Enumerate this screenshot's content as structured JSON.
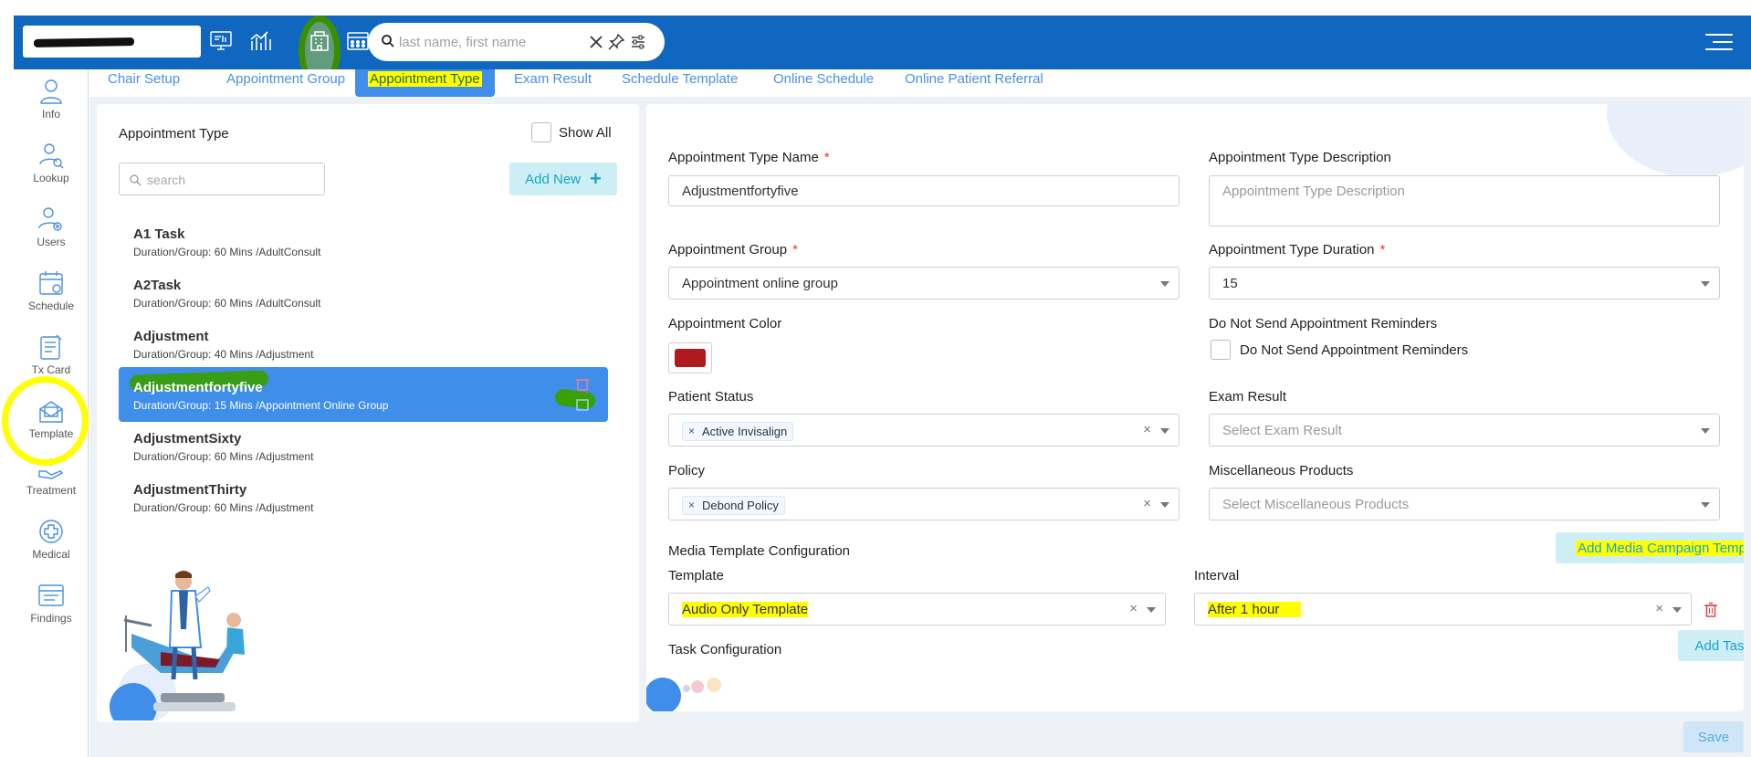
{
  "header": {
    "search_placeholder": "last name, first name",
    "nav_icons": [
      "dashboard-icon",
      "chart-bar-icon",
      "building-icon",
      "calendar-grid-icon"
    ],
    "accent_color": "#0f67c0"
  },
  "sidebar": {
    "items": [
      {
        "label": "Info",
        "icon": "user-icon"
      },
      {
        "label": "Lookup",
        "icon": "user-search-icon"
      },
      {
        "label": "Users",
        "icon": "user-settings-icon"
      },
      {
        "label": "Schedule",
        "icon": "calendar-icon"
      },
      {
        "label": "Tx Card",
        "icon": "card-icon"
      },
      {
        "label": "Template",
        "icon": "template-icon"
      },
      {
        "label": "Treatment",
        "icon": "hand-care-icon"
      },
      {
        "label": "Medical",
        "icon": "medical-cross-icon"
      },
      {
        "label": "Findings",
        "icon": "findings-icon"
      }
    ]
  },
  "tabs": [
    {
      "label": "Chair Setup"
    },
    {
      "label": "Appointment Group"
    },
    {
      "label": "Appointment Type",
      "active": true
    },
    {
      "label": "Exam Result"
    },
    {
      "label": "Schedule Template"
    },
    {
      "label": "Online Schedule"
    },
    {
      "label": "Online Patient Referral"
    }
  ],
  "left_panel": {
    "title": "Appointment Type",
    "show_all_label": "Show All",
    "search_placeholder": "search",
    "add_new_label": "Add New",
    "items": [
      {
        "name": "A1 Task",
        "sub": "Duration/Group: 60 Mins /AdultConsult"
      },
      {
        "name": "A2Task",
        "sub": "Duration/Group: 60 Mins /AdultConsult"
      },
      {
        "name": "Adjustment",
        "sub": "Duration/Group: 40 Mins /Adjustment"
      },
      {
        "name": "Adjustmentfortyfive",
        "sub": "Duration/Group: 15 Mins /Appointment Online Group",
        "selected": true
      },
      {
        "name": "AdjustmentSixty",
        "sub": "Duration/Group: 60 Mins /Adjustment"
      },
      {
        "name": "AdjustmentThirty",
        "sub": "Duration/Group: 60 Mins /Adjustment"
      }
    ]
  },
  "form": {
    "type_name_label": "Appointment Type Name",
    "type_name_value": "Adjustmentfortyfive",
    "description_label": "Appointment Type Description",
    "description_placeholder": "Appointment Type Description",
    "group_label": "Appointment Group",
    "group_value": "Appointment online group",
    "duration_label": "Appointment Type Duration",
    "duration_value": "15",
    "color_label": "Appointment Color",
    "color_value": "#b0191e",
    "no_reminders_label": "Do Not Send Appointment Reminders",
    "no_reminders_checkbox_label": "Do Not Send Appointment Reminders",
    "patient_status_label": "Patient Status",
    "patient_status_tag": "Active Invisalign",
    "exam_result_label": "Exam Result",
    "exam_result_placeholder": "Select Exam Result",
    "policy_label": "Policy",
    "policy_tag": "Debond Policy",
    "misc_products_label": "Miscellaneous Products",
    "misc_products_placeholder": "Select Miscellaneous Products",
    "media_config_label": "Media Template Configuration",
    "add_media_campaign_label": "Add Media Campaign Template",
    "template_label": "Template",
    "template_value": "Audio Only Template",
    "interval_label": "Interval",
    "interval_value": "After 1 hour",
    "task_config_label": "Task Configuration",
    "add_task_config_label": "Add Task Config",
    "required_mark": "*"
  },
  "footer": {
    "save_label": "Save"
  }
}
